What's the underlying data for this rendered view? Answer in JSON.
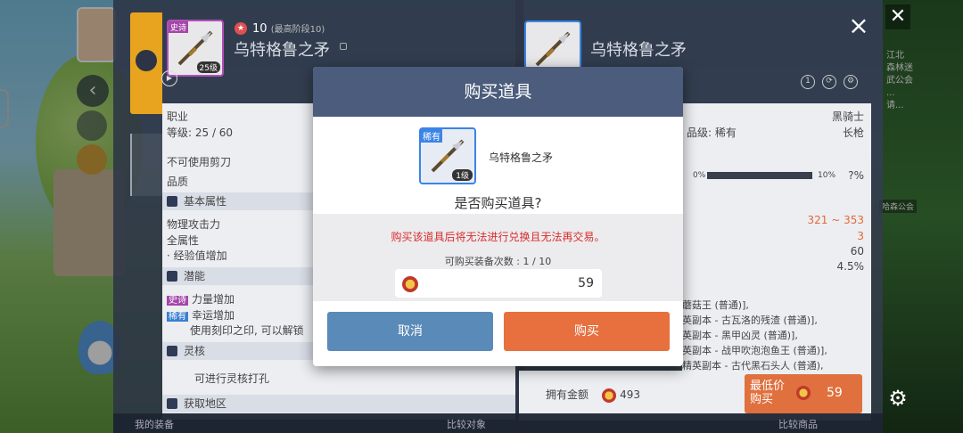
{
  "background": {
    "right_text": "江北\n森林迷\n武公会\n...\n请...",
    "right_badge": "哈森公会"
  },
  "left_panel": {
    "item": {
      "rarity": "史诗",
      "level_badge": "25级"
    },
    "star_level": "10",
    "star_level_note": "(最高阶段10)",
    "name": "乌特格鲁之矛",
    "job_label": "职业",
    "level_label": "等级: 25 / 60",
    "no_scissors": "不可使用剪刀",
    "quality_label": "品质",
    "basic_section": "基本属性",
    "attrs": [
      "物理攻击力",
      "全属性",
      "· 经验值增加"
    ],
    "potential_section": "潜能",
    "potentials": [
      {
        "tag": "史诗",
        "text": "力量增加"
      },
      {
        "tag": "稀有",
        "text": "幸运增加"
      },
      {
        "tag": "",
        "text": "使用刻印之印, 可以解锁"
      }
    ],
    "soul_section": "灵核",
    "soul_text": "可进行灵核打孔",
    "source_section": "获取地区"
  },
  "right_panel": {
    "name": "乌特格鲁之矛",
    "job": "黑骑士",
    "grade": "品级: 稀有",
    "weapon_type": "长枪",
    "pct_left": "0%",
    "pct_right": "10%",
    "pct_unknown": "?%",
    "stats": [
      "321 ~ 353",
      "3",
      "60",
      "4.5%"
    ],
    "sources": [
      "蘑菇王 (普通)],",
      "英副本 - 古瓦洛的残渣 (普通)],",
      "英副本 - 黑甲凶灵 (普通)],",
      "英副本 - 战甲吹泡泡鱼王 (普通)],",
      "精英副本 - 古代黑石头人 (普通),"
    ],
    "owned_label": "拥有金额",
    "owned_value": "493",
    "lowest_buy_label": "最低价\n购买",
    "lowest_buy_price": "59"
  },
  "bottom_bar": {
    "left": "我的装备",
    "middle": "比较对象",
    "right": "比较商品"
  },
  "modal": {
    "title": "购买道具",
    "item_rarity": "稀有",
    "item_level": "1级",
    "item_name": "乌特格鲁之矛",
    "question": "是否购买道具?",
    "warning": "购买该道具后将无法进行兑换且无法再交易。",
    "count_text": "可购买装备次数 : 1 / 10",
    "price": "59",
    "cancel_label": "取消",
    "buy_label": "购买"
  }
}
